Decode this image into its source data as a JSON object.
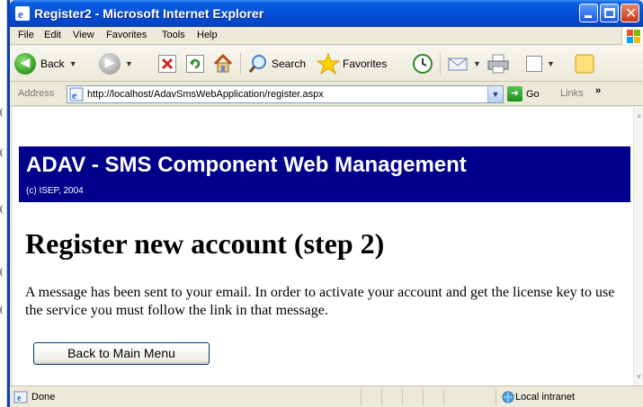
{
  "window": {
    "title": "Register2 - Microsoft Internet Explorer"
  },
  "menu": {
    "items": [
      "File",
      "Edit",
      "View",
      "Favorites",
      "Tools",
      "Help"
    ]
  },
  "toolbar": {
    "back_label": "Back",
    "search_label": "Search",
    "favorites_label": "Favorites"
  },
  "address": {
    "label": "Address",
    "url": "http://localhost/AdavSmsWebApplication/register.aspx",
    "go_label": "Go",
    "links_label": "Links"
  },
  "page": {
    "banner_title": "ADAV - SMS Component Web Management",
    "banner_subtitle": "(c) ISEP, 2004",
    "heading": "Register new account (step 2)",
    "message": "A message has been sent to your email. In order to activate your account and get the license key to use the service you must follow the link in that message.",
    "back_button_label": "Back to Main Menu"
  },
  "status": {
    "text": "Done",
    "zone": "Local intranet"
  },
  "colors": {
    "banner_bg": "#00008b",
    "titlebar_blue": "#0550d6",
    "chrome_bg": "#ece9d8"
  },
  "icons": [
    "ie-logo-icon",
    "minimize-icon",
    "maximize-icon",
    "close-icon",
    "windows-logo-icon",
    "back-icon",
    "forward-icon",
    "stop-icon",
    "refresh-icon",
    "home-icon",
    "search-icon",
    "favorites-star-icon",
    "history-icon",
    "mail-icon",
    "print-icon",
    "edit-icon",
    "messenger-icon",
    "page-icon",
    "go-arrow-icon",
    "done-page-icon",
    "local-intranet-icon"
  ]
}
